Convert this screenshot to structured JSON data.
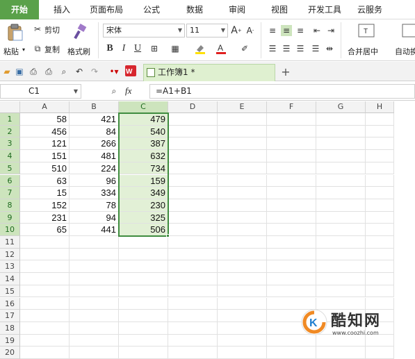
{
  "menu": {
    "tabs": [
      {
        "label": "开始",
        "active": true
      },
      {
        "label": "插入"
      },
      {
        "label": "页面布局"
      },
      {
        "label": "公式"
      },
      {
        "label": "数据"
      },
      {
        "label": "审阅"
      },
      {
        "label": "视图"
      },
      {
        "label": "开发工具"
      },
      {
        "label": "云服务"
      }
    ]
  },
  "ribbon": {
    "paste": "粘贴",
    "cut": "剪切",
    "copy": "复制",
    "format_painter": "格式刷",
    "font_name": "宋体",
    "font_size": "11",
    "bold": "B",
    "italic": "I",
    "underline": "U",
    "merge_center": "合并居中",
    "auto_wrap": "自动换"
  },
  "doc_tab": {
    "title": "工作簿1 *"
  },
  "formula_bar": {
    "cell_ref": "C1",
    "fx": "fx",
    "formula": "=A1+B1"
  },
  "sheet": {
    "columns": [
      "A",
      "B",
      "C",
      "D",
      "E",
      "F",
      "G",
      "H"
    ],
    "rows": [
      "1",
      "2",
      "3",
      "4",
      "5",
      "6",
      "7",
      "8",
      "9",
      "10",
      "11",
      "12",
      "13",
      "14",
      "15",
      "16",
      "17",
      "18",
      "19",
      "20"
    ],
    "data": [
      [
        "58",
        "421",
        "479"
      ],
      [
        "456",
        "84",
        "540"
      ],
      [
        "121",
        "266",
        "387"
      ],
      [
        "151",
        "481",
        "632"
      ],
      [
        "510",
        "224",
        "734"
      ],
      [
        "63",
        "96",
        "159"
      ],
      [
        "15",
        "334",
        "349"
      ],
      [
        "152",
        "78",
        "230"
      ],
      [
        "231",
        "94",
        "325"
      ],
      [
        "65",
        "441",
        "506"
      ]
    ]
  },
  "watermark": {
    "name": "酷知网",
    "url": "www.coozhi.com"
  },
  "colors": {
    "accent": "#5aa14a",
    "selection": "#3f8c3f",
    "selection_fill": "#e2f0d6"
  }
}
